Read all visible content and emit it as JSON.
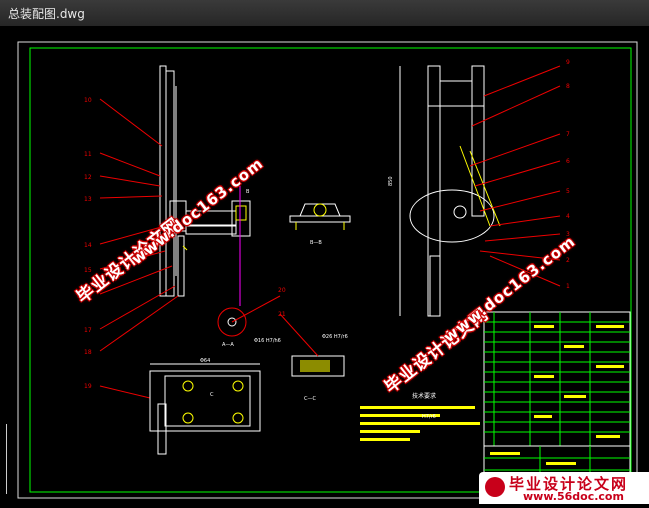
{
  "window": {
    "title": "总装配图.dwg"
  },
  "drawing": {
    "left_callouts": [
      "10",
      "11",
      "12",
      "13",
      "14",
      "15",
      "16",
      "17",
      "18",
      "19"
    ],
    "right_callouts": [
      "9",
      "8",
      "7",
      "6",
      "5",
      "4",
      "3",
      "2",
      "1"
    ],
    "mid_callouts": [
      "20",
      "21"
    ],
    "section_labels": {
      "aa": "A—A",
      "bb": "B—B",
      "cc": "C—C",
      "b": "B",
      "c": "C"
    },
    "dims": {
      "d1": "Φ16 H7/h6",
      "d2": "Φ26 H7/r6",
      "d3": "850",
      "d4": "Φ64"
    },
    "notes_title": "技术要求",
    "notes_line": "H7/r6"
  },
  "watermark": {
    "text_cn": "毕业设计论文网",
    "text_url": "www.doc163.com"
  },
  "corner_logo": {
    "text_cn": "毕业设计论文网",
    "text_url": "www.56doc.com"
  }
}
